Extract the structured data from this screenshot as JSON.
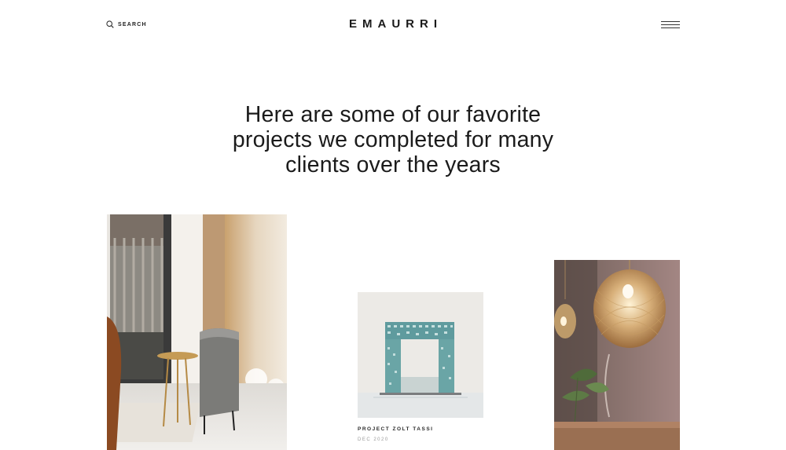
{
  "header": {
    "search_label": "SEARCH",
    "logo_text": "EMAURRI",
    "search_icon": "search-icon",
    "menu_icon": "hamburger-menu-icon"
  },
  "main": {
    "headline_lines": [
      "Here are some of our favorite",
      "projects we completed for many",
      "clients over the years"
    ]
  },
  "projects": [
    {
      "image": "interior-chair-window-photo",
      "title": "",
      "date": ""
    },
    {
      "image": "modern-building-photo",
      "title": "PROJECT ZOLT TASSI",
      "date": "DEC 2020"
    },
    {
      "image": "pendant-lamp-photo",
      "title": "",
      "date": ""
    }
  ],
  "colors": {
    "background": "#ffffff",
    "text": "#1b1b1b",
    "muted": "#9a9a9a"
  }
}
